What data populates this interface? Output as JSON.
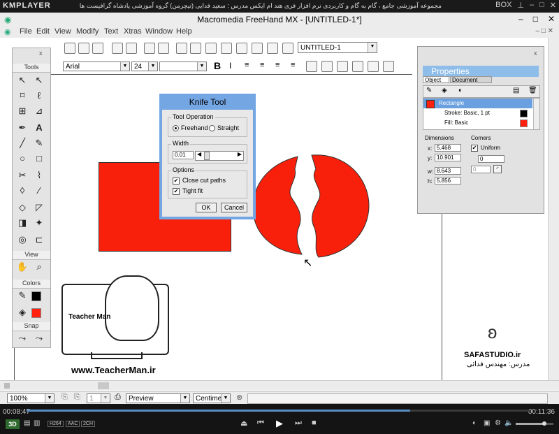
{
  "kmplayer": {
    "logo": "KMPLAYER",
    "caption": "مجموعه آموزشی جامع ، گام به گام و کاربردی نرم افزار فری هند ام ایکس   مدرس : سعید فدایی (تیچرمن) گروه آموزشی پادشاه گرافیست ها",
    "box_label": "BOX",
    "time_elapsed": "00:08:47",
    "time_total": "00:11:36",
    "progress_fraction": 0.76,
    "codec_badges": [
      "H264",
      "AAC",
      "2CH"
    ],
    "mode_badge": "3D"
  },
  "app": {
    "title": "Macromedia FreeHand MX - [UNTITLED-1*]",
    "menu": [
      "File",
      "Edit",
      "View",
      "Modify",
      "Text",
      "Xtras",
      "Window",
      "Help"
    ]
  },
  "doc_toolbar": {
    "page_name": "UNTITLED-1"
  },
  "text_toolbar": {
    "font": "Arial",
    "size": "24",
    "bold": "B"
  },
  "tools_panel": {
    "title": "Tools",
    "view_label": "View",
    "colors_label": "Colors",
    "snap_label": "Snap",
    "stroke_color": "#000000",
    "fill_color": "#ff2010"
  },
  "knife_dialog": {
    "title": "Knife Tool",
    "operation_label": "Tool Operation",
    "freehand_label": "Freehand",
    "straight_label": "Straight",
    "width_label": "Width",
    "width_value": "0.01",
    "options_label": "Options",
    "close_cut_paths_label": "Close cut paths",
    "tight_fit_label": "Tight fit",
    "ok_label": "OK",
    "cancel_label": "Cancel"
  },
  "properties": {
    "title": "Properties",
    "tab_object": "Object",
    "tab_document": "Document",
    "items": [
      {
        "label": "Rectangle",
        "swatch": "#ff2010"
      },
      {
        "label": "Stroke: Basic, 1 pt",
        "swatch": "#000000"
      },
      {
        "label": "Fill: Basic",
        "swatch": "#ff2010"
      }
    ],
    "dimensions_label": "Dimensions",
    "corners_label": "Corners",
    "x_label": "x:",
    "x_value": "5.468",
    "y_label": "y:",
    "y_value": "10.901",
    "w_label": "w:",
    "w_value": "8.643",
    "h_label": "h:",
    "h_value": "5.856",
    "uniform_label": "Uniform",
    "corner_value": "0",
    "corner_value2": "0"
  },
  "status": {
    "zoom": "100%",
    "page": "1",
    "preview_mode": "Preview",
    "units": "Centimeter"
  },
  "watermarks": {
    "teacherman_url": "www.TeacherMan.ir",
    "teacherman_name": "Teacher Man",
    "safa_url": "SAFASTUDIO.ir",
    "safa_teacher": "مدرس: مهندس فدائی"
  }
}
